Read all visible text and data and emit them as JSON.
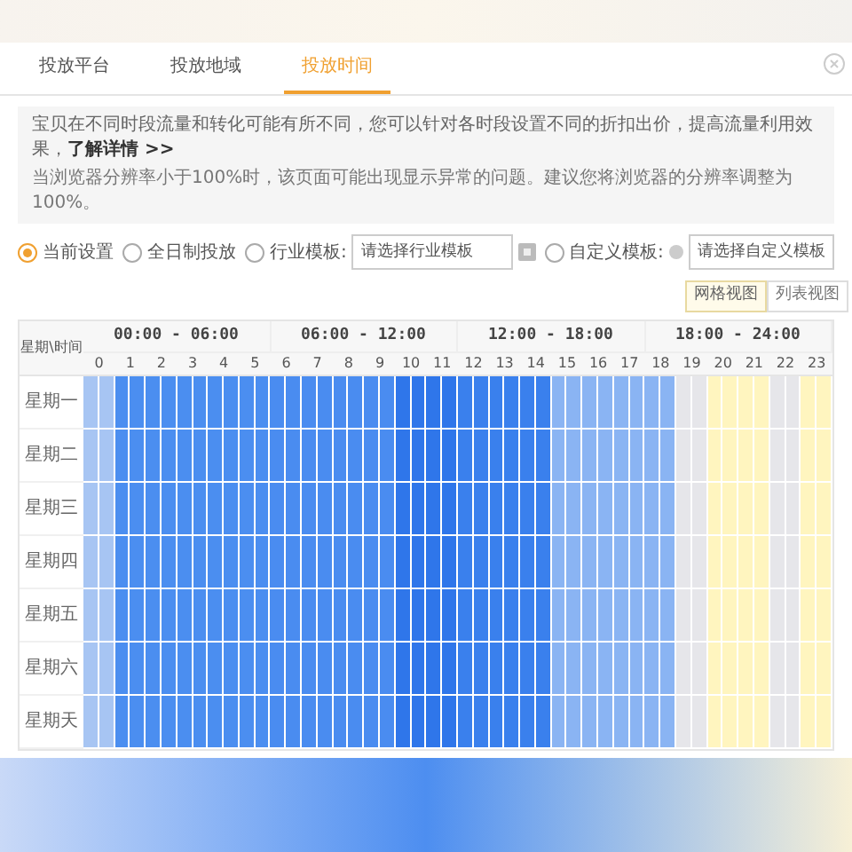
{
  "tabs": [
    {
      "label": "投放平台",
      "selected": false
    },
    {
      "label": "投放地域",
      "selected": false
    },
    {
      "label": "投放时间",
      "selected": true
    }
  ],
  "notice": {
    "line_1": "宝贝在不同时段流量和转化可能有所不同，您可以针对各时段设置不同的折扣出价，提高流量利用效果，",
    "link": "了解详情 >>",
    "line_2": "当浏览器分辨率小于100%时，该页面可能出现显示异常的问题。建议您将浏览器的分辨率调整为100%。"
  },
  "options": [
    {
      "kind": "plain",
      "label": "当前设置",
      "selected": true
    },
    {
      "kind": "plain",
      "label": "全日制投放",
      "selected": false
    },
    {
      "kind": "industry",
      "label": "行业模板:",
      "selected": false,
      "placeholder": "请选择行业模板"
    },
    {
      "kind": "custom",
      "label": "自定义模板:",
      "selected": false,
      "placeholder": "请选择自定义模板"
    }
  ],
  "views": [
    {
      "label": "网格视图",
      "selected": true
    },
    {
      "label": "列表视图",
      "selected": false
    }
  ],
  "grid": {
    "corner": "星期\\时间",
    "groups": [
      "00:00 - 06:00",
      "06:00 - 12:00",
      "12:00 - 18:00",
      "18:00 - 24:00"
    ],
    "hours": [
      {
        "label": "0",
        "color": "#a7c5f3"
      },
      {
        "label": "1",
        "color": "#4b8ef0"
      },
      {
        "label": "2",
        "color": "#4b8ef0"
      },
      {
        "label": "3",
        "color": "#4b8ef0"
      },
      {
        "label": "4",
        "color": "#4b8ef0"
      },
      {
        "label": "5",
        "color": "#4b8ef0"
      },
      {
        "label": "6",
        "color": "#4a8cf0"
      },
      {
        "label": "7",
        "color": "#4a8cf0"
      },
      {
        "label": "8",
        "color": "#4a8cf0"
      },
      {
        "label": "9",
        "color": "#4a8cf0"
      },
      {
        "label": "10",
        "color": "#2f76ea"
      },
      {
        "label": "11",
        "color": "#2f76ea"
      },
      {
        "label": "12",
        "color": "#3a80ed"
      },
      {
        "label": "13",
        "color": "#3a80ed"
      },
      {
        "label": "14",
        "color": "#3a80ed"
      },
      {
        "label": "15",
        "color": "#8ab4f3"
      },
      {
        "label": "16",
        "color": "#8ab4f3"
      },
      {
        "label": "17",
        "color": "#8ab4f3"
      },
      {
        "label": "18",
        "color": "#8ab4f3"
      },
      {
        "label": "19",
        "color": "#e6e6ea"
      },
      {
        "label": "20",
        "color": "#fff5bf"
      },
      {
        "label": "21",
        "color": "#fff5bf"
      },
      {
        "label": "22",
        "color": "#e6e6ea"
      },
      {
        "label": "23",
        "color": "#fff5bf"
      }
    ],
    "days": [
      "星期一",
      "星期二",
      "星期三",
      "星期四",
      "星期五",
      "星期六",
      "星期天"
    ]
  }
}
